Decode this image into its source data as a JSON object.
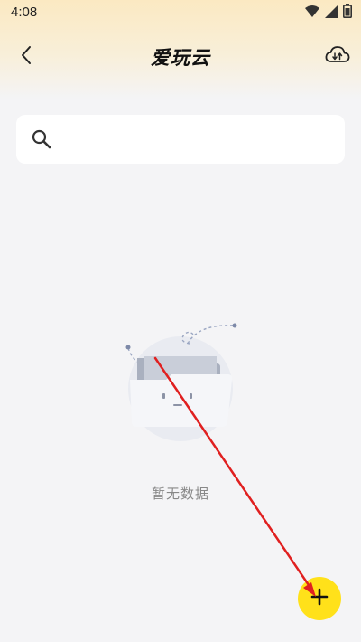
{
  "status_bar": {
    "time": "4:08",
    "icons": [
      "wifi-icon",
      "signal-icon",
      "battery-icon"
    ]
  },
  "header": {
    "title": "爱玩云",
    "back_icon": "chevron-left-icon",
    "cloud_icon": "cloud-sync-icon"
  },
  "search": {
    "placeholder": "",
    "value": "",
    "icon": "search-icon"
  },
  "empty_state": {
    "illustration": "empty-folder-icon",
    "text": "暂无数据"
  },
  "fab": {
    "icon": "plus-icon",
    "color": "#ffe11a"
  },
  "annotation": {
    "arrow_color": "#e02020",
    "description_icon": "annotation-arrow"
  },
  "colors": {
    "background": "#f4f4f6",
    "header_gradient_top": "#fbe9c2",
    "accent": "#ffe11a"
  }
}
